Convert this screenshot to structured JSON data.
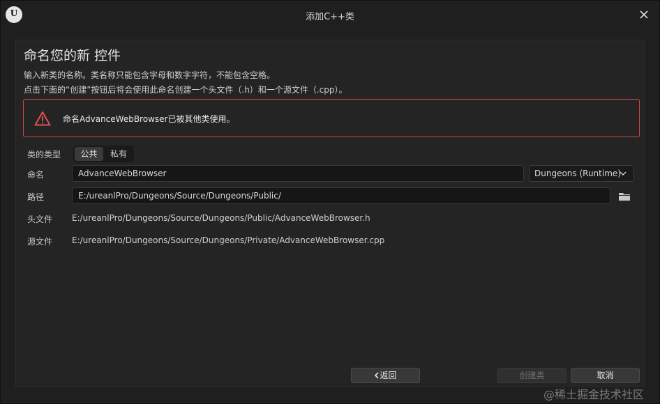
{
  "window": {
    "title": "添加C++类",
    "logo_text": "U"
  },
  "panel": {
    "heading": "命名您的新 控件",
    "desc_line1": "输入新类的名称。类名称只能包含字母和数字字符，不能包含空格。",
    "desc_line2": "点击下面的“创建”按钮后将会使用此命名创建一个头文件（.h）和一个源文件（.cpp）。"
  },
  "error": {
    "message": "命名AdvanceWebBrowser已被其他类使用。",
    "icon": "warning-triangle-icon",
    "color": "#d14545"
  },
  "form": {
    "class_type_label": "类的类型",
    "class_type_options": [
      "公共",
      "私有"
    ],
    "class_type_selected": "公共",
    "name_label": "命名",
    "name_value": "AdvanceWebBrowser",
    "module_value": "Dungeons (Runtime)",
    "path_label": "路径",
    "path_value": "E:/ureanlPro/Dungeons/Source/Dungeons/Public/",
    "header_label": "头文件",
    "header_value": "E:/ureanlPro/Dungeons/Source/Dungeons/Public/AdvanceWebBrowser.h",
    "source_label": "源文件",
    "source_value": "E:/ureanlPro/Dungeons/Source/Dungeons/Private/AdvanceWebBrowser.cpp"
  },
  "buttons": {
    "back": "返回",
    "create": "创建类",
    "cancel": "取消"
  },
  "watermark": "@稀土掘金技术社区"
}
